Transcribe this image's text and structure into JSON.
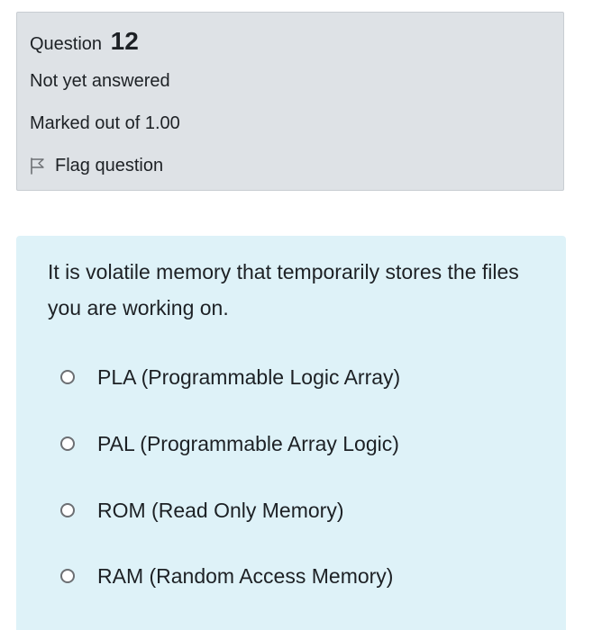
{
  "question_info": {
    "label": "Question",
    "number": "12",
    "state": "Not yet answered",
    "grade": "Marked out of 1.00",
    "flag_label": "Flag question",
    "flag_icon": "flag-icon"
  },
  "question": {
    "text": "It is volatile memory that temporarily stores the files you are working on.",
    "options": [
      {
        "label": "PLA (Programmable Logic Array)",
        "selected": false
      },
      {
        "label": "PAL (Programmable Array Logic)",
        "selected": false
      },
      {
        "label": "ROM (Read Only Memory)",
        "selected": false
      },
      {
        "label": "RAM (Random Access Memory)",
        "selected": false
      }
    ]
  },
  "colors": {
    "info_background": "#dee2e6",
    "content_background": "#def2f8",
    "text": "#1d2125"
  }
}
